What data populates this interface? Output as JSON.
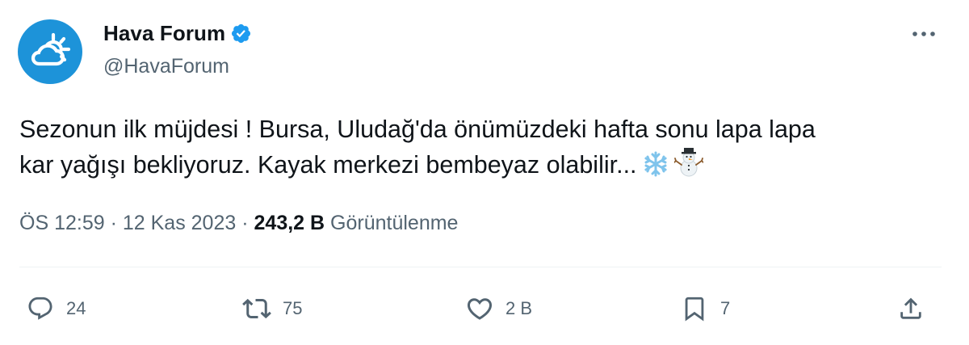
{
  "tweet": {
    "display_name": "Hava Forum",
    "handle": "@HavaForum",
    "verified": true,
    "avatar_icon": "cloud-sun-icon",
    "text_line1": "Sezonun ilk müjdesi ! Bursa, Uludağ'da önümüzdeki hafta sonu lapa lapa",
    "text_line2": "kar yağışı bekliyoruz. Kayak merkezi bembeyaz olabilir...",
    "emojis": [
      "snowflake-icon",
      "snowman-icon"
    ],
    "time": "ÖS 12:59",
    "separator": "·",
    "date": "12 Kas 2023",
    "views_count": "243,2 B",
    "views_label": "Görüntülenme"
  },
  "actions": {
    "reply_count": "24",
    "retweet_count": "75",
    "like_count": "2 B",
    "bookmark_count": "7"
  },
  "colors": {
    "text": "#0f1419",
    "muted": "#536471",
    "verified": "#1d9bf0",
    "avatar_bg": "#1d93d9",
    "divider": "#eff3f4"
  }
}
